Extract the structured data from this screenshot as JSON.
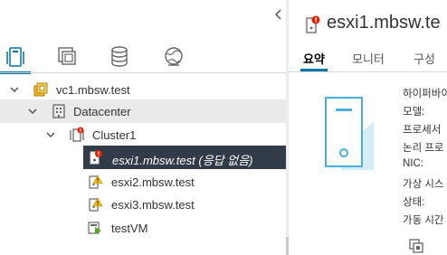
{
  "navigator": {
    "tree": {
      "vcenter": "vc1.mbsw.test",
      "datacenter": "Datacenter",
      "cluster": "Cluster1",
      "hosts": [
        "esxi1.mbsw.test (응답 없음)",
        "esxi2.mbsw.test",
        "esxi3.mbsw.test"
      ],
      "vm": "testVM"
    }
  },
  "content": {
    "title": "esxi1.mbsw.te",
    "tabs": [
      "요약",
      "모니터",
      "구성"
    ],
    "summary_labels": [
      "하이퍼바이",
      "모델:",
      "프로세서",
      "논리 프로",
      "NIC:",
      "가상 시스",
      "상태:",
      "가동 시간"
    ]
  },
  "colors": {
    "accent": "#0072a3",
    "selected_row": "#313c48",
    "alert_red": "#e12200",
    "warning_yellow": "#fac400",
    "vcenter_yellow": "#eab830",
    "vm_green": "#5aa220"
  }
}
